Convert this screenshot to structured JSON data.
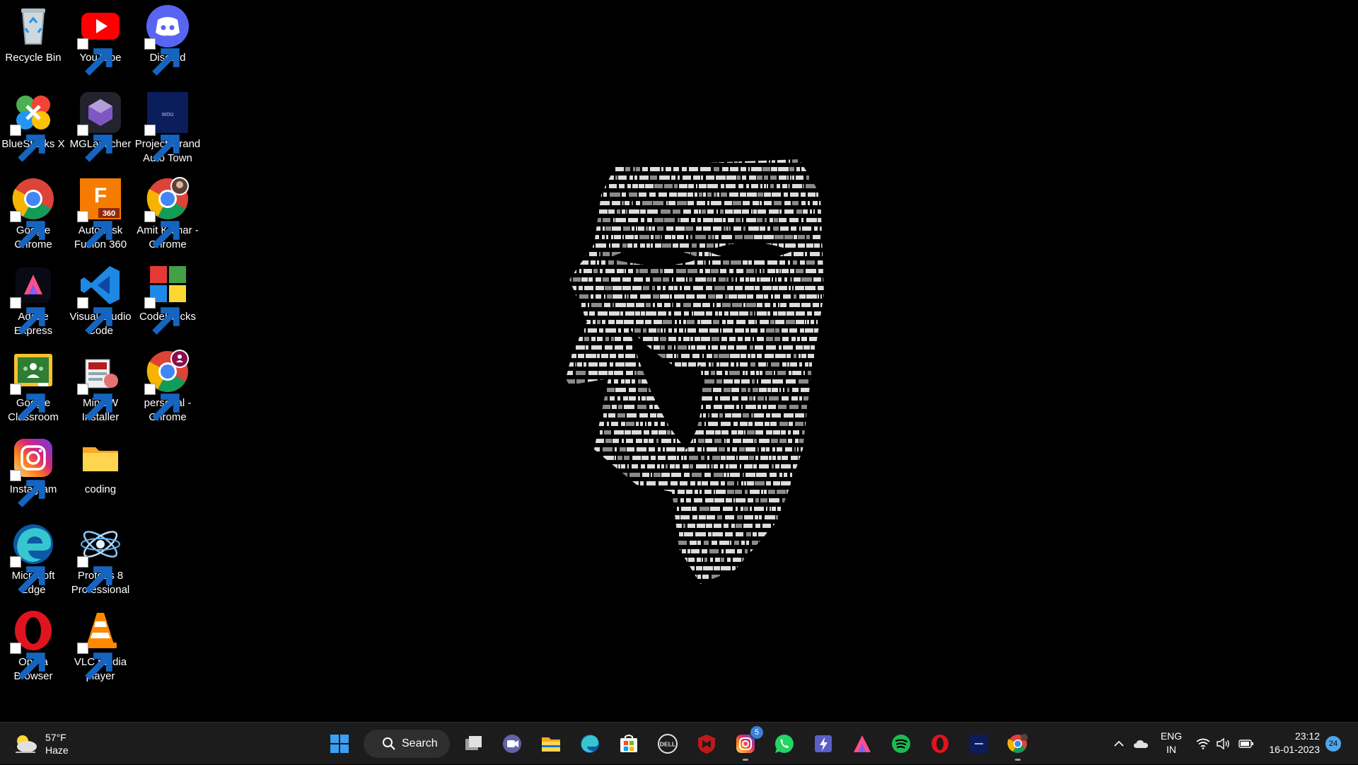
{
  "desktop": {
    "icons": [
      {
        "label": "Recycle Bin",
        "icon": "recycle-bin-icon"
      },
      {
        "label": "YouTube",
        "icon": "youtube-icon"
      },
      {
        "label": "Discord",
        "icon": "discord-icon"
      },
      {
        "label": "BlueStacks X",
        "icon": "bluestacks-icon"
      },
      {
        "label": "MGLauncher",
        "icon": "mglauncher-icon"
      },
      {
        "label": "Project Grand Auto Town",
        "icon": "project-grand-auto-town-icon"
      },
      {
        "label": "Google Chrome",
        "icon": "chrome-icon"
      },
      {
        "label": "Autodesk Fusion 360",
        "icon": "fusion360-icon"
      },
      {
        "label": "Amit Kumar - Chrome",
        "icon": "chrome-profile-icon"
      },
      {
        "label": "Adobe Express",
        "icon": "adobe-express-icon"
      },
      {
        "label": "Visual Studio Code",
        "icon": "vscode-icon"
      },
      {
        "label": "CodeBlocks",
        "icon": "codeblocks-icon"
      },
      {
        "label": "Google Classroom",
        "icon": "google-classroom-icon"
      },
      {
        "label": "MinGW Installer",
        "icon": "mingw-icon"
      },
      {
        "label": "personal - Chrome",
        "icon": "chrome-profile-icon"
      },
      {
        "label": "Instagram",
        "icon": "instagram-icon"
      },
      {
        "label": "coding",
        "icon": "folder-icon"
      },
      {
        "label": "Microsoft Edge",
        "icon": "edge-icon"
      },
      {
        "label": "Proteus 8 Professional",
        "icon": "proteus-icon"
      },
      {
        "label": "Opera Browser",
        "icon": "opera-icon"
      },
      {
        "label": "VLC media player",
        "icon": "vlc-icon"
      }
    ],
    "wallpaper": "anonymous-mask-code-art"
  },
  "taskbar": {
    "weather": {
      "temp": "57°F",
      "condition": "Haze",
      "icon": "weather-haze-icon"
    },
    "search_label": "Search",
    "apps": [
      {
        "name": "start",
        "icon": "windows-start-icon"
      },
      {
        "name": "task-view",
        "icon": "task-view-icon"
      },
      {
        "name": "teams-chat",
        "icon": "chat-icon"
      },
      {
        "name": "file-explorer",
        "icon": "folder-icon"
      },
      {
        "name": "edge",
        "icon": "edge-icon"
      },
      {
        "name": "microsoft-store",
        "icon": "store-icon"
      },
      {
        "name": "dell",
        "icon": "dell-icon"
      },
      {
        "name": "mcafee",
        "icon": "mcafee-icon"
      },
      {
        "name": "instagram",
        "icon": "instagram-icon",
        "badge": "5"
      },
      {
        "name": "whatsapp",
        "icon": "whatsapp-icon"
      },
      {
        "name": "power-automate",
        "icon": "lightning-icon"
      },
      {
        "name": "adobe-express",
        "icon": "adobe-express-icon"
      },
      {
        "name": "spotify",
        "icon": "spotify-icon"
      },
      {
        "name": "opera",
        "icon": "opera-icon"
      },
      {
        "name": "project-grand-auto-town",
        "icon": "project-grand-auto-town-icon"
      },
      {
        "name": "chrome",
        "icon": "chrome-profile-icon"
      }
    ],
    "tray": {
      "language_line1": "ENG",
      "language_line2": "IN",
      "time": "23:12",
      "date": "16-01-2023",
      "notifications": "24"
    }
  },
  "colors": {
    "taskbar_bg": "#1c1c1c",
    "desktop_bg": "#000000",
    "accent_blue": "#3b7fd6"
  }
}
